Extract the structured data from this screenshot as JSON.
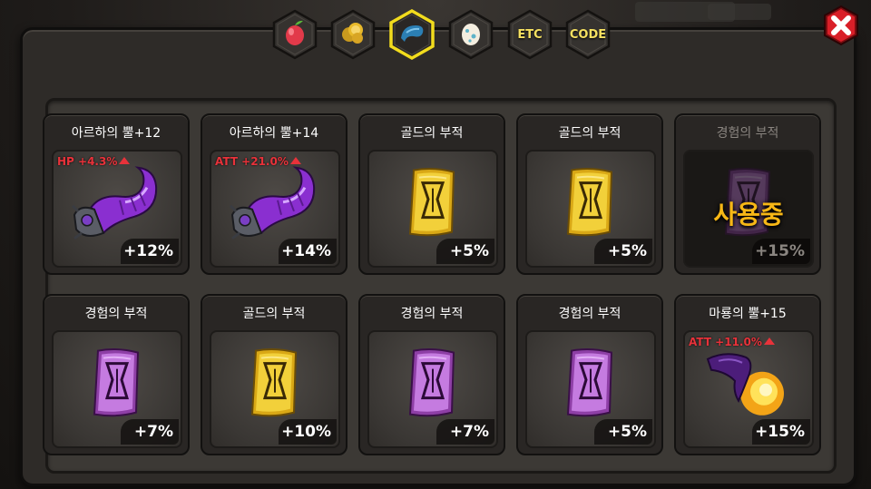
{
  "tabs": [
    {
      "name": "fruit",
      "icon": "fruit-icon",
      "label": ""
    },
    {
      "name": "gold",
      "icon": "gold-coins-icon",
      "label": ""
    },
    {
      "name": "horn",
      "icon": "horn-icon",
      "label": ""
    },
    {
      "name": "egg",
      "icon": "egg-icon",
      "label": ""
    },
    {
      "name": "etc",
      "icon": "",
      "label": "ETC"
    },
    {
      "name": "code",
      "icon": "",
      "label": "CODE"
    }
  ],
  "active_tab": "horn",
  "close_icon": "close-x-icon",
  "items": [
    {
      "name": "아르하의 뿔+12",
      "stat": "HP +4.3%",
      "pct": "+12%",
      "art": "purple-horn",
      "in_use": ""
    },
    {
      "name": "아르하의 뿔+14",
      "stat": "ATT +21.0%",
      "pct": "+14%",
      "art": "purple-horn",
      "in_use": ""
    },
    {
      "name": "골드의 부적",
      "stat": "",
      "pct": "+5%",
      "art": "gold-charm",
      "in_use": ""
    },
    {
      "name": "골드의 부적",
      "stat": "",
      "pct": "+5%",
      "art": "gold-charm",
      "in_use": ""
    },
    {
      "name": "경험의 부적",
      "stat": "",
      "pct": "+15%",
      "art": "purple-charm",
      "in_use": "사용중"
    },
    {
      "name": "경험의 부적",
      "stat": "",
      "pct": "+7%",
      "art": "purple-charm",
      "in_use": ""
    },
    {
      "name": "골드의 부적",
      "stat": "",
      "pct": "+10%",
      "art": "gold-charm",
      "in_use": ""
    },
    {
      "name": "경험의 부적",
      "stat": "",
      "pct": "+7%",
      "art": "purple-charm",
      "in_use": ""
    },
    {
      "name": "경험의 부적",
      "stat": "",
      "pct": "+5%",
      "art": "purple-charm",
      "in_use": ""
    },
    {
      "name": "마룡의 뿔+15",
      "stat": "ATT +11.0%",
      "pct": "+15%",
      "art": "dragon-horn",
      "in_use": ""
    }
  ],
  "colors": {
    "tab_gold": "#f5e060",
    "active_border": "#f2dc1d",
    "stat_red": "#e8323a",
    "in_use_orange": "#f7b716",
    "close_red": "#d91f28"
  }
}
